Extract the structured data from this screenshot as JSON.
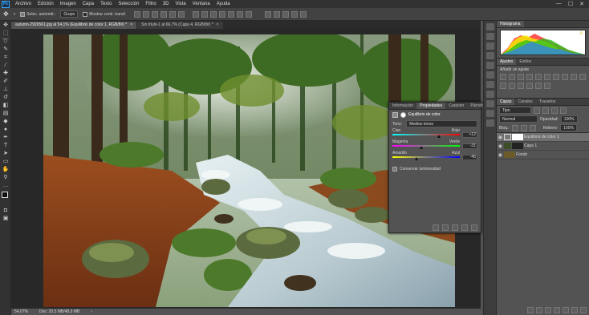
{
  "menubar": {
    "logo": "Ps",
    "items": [
      "Archivo",
      "Edición",
      "Imagen",
      "Capa",
      "Texto",
      "Selección",
      "Filtro",
      "3D",
      "Vista",
      "Ventana",
      "Ayuda"
    ],
    "win_min": "—",
    "win_max": "☐",
    "win_close": "✕"
  },
  "options": {
    "auto_select_label": "Selec. automát.:",
    "auto_select_value": "Grupo",
    "show_transform_label": "Mostrar contr. transf."
  },
  "doc_tabs": [
    {
      "title": "autumn-2926561.jpg al 54,1% (Equilibrio de color 1, RGB/8#) *",
      "close": "×"
    },
    {
      "title": "Sin título-1 al 66,7% (Capa 4, RGB/8#) *",
      "close": "×"
    }
  ],
  "status": {
    "zoom": "54,07%",
    "doc": "Doc: 20,5 MB/48,9 MB",
    "arrow": "›"
  },
  "histogram": {
    "tab": "Histograma",
    "warning": "⚠"
  },
  "adjustments": {
    "tabs": [
      "Ajustes",
      "Estilos"
    ],
    "hint": "Añadir un ajuste"
  },
  "properties": {
    "tabs": [
      "Información",
      "Propiedades",
      "Carácter",
      "Párrafo"
    ],
    "title": "Equilibrio de color",
    "tone_label": "Tono:",
    "tone_value": "Medios tonos",
    "sliders": [
      {
        "left": "Cian",
        "right": "Rojo",
        "value": "+12"
      },
      {
        "left": "Magenta",
        "right": "Verde",
        "value": "-31"
      },
      {
        "left": "Amarillo",
        "right": "Azul",
        "value": "-45"
      }
    ],
    "preserve_label": "Conservar luminosidad"
  },
  "layers": {
    "tabs": [
      "Capas",
      "Canales",
      "Trazados"
    ],
    "kind_label": "Tipo",
    "blend_mode": "Normal",
    "opacity_label": "Opacidad:",
    "opacity_value": "100%",
    "lock_label": "Bloq.:",
    "fill_label": "Relleno:",
    "fill_value": "100%",
    "items": [
      {
        "name": "Equilibrio de color 1"
      },
      {
        "name": "Capa 1"
      },
      {
        "name": "Fondo"
      }
    ]
  },
  "colors": {
    "accent": "#31a8ff",
    "panel": "#535353",
    "dark": "#323232"
  }
}
